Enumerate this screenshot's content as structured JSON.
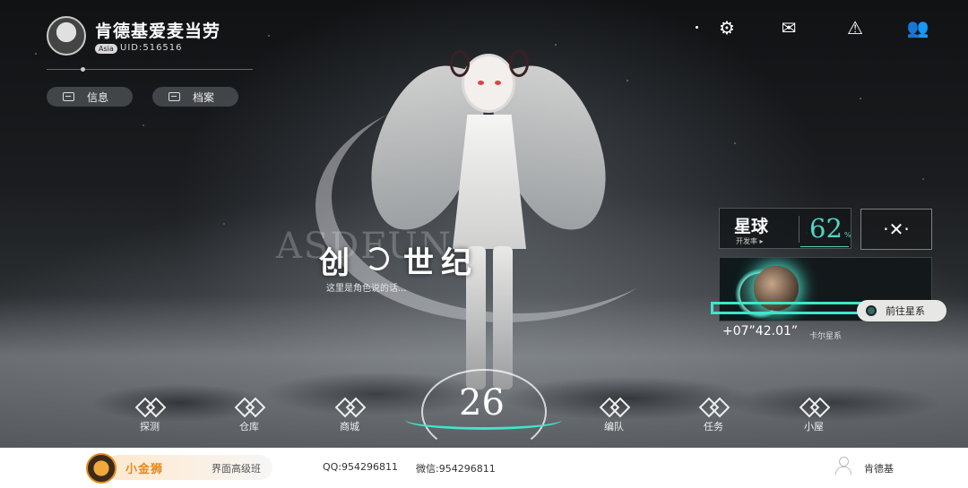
{
  "profile": {
    "username": "肯德基爱麦当劳",
    "region": "Asia",
    "uid": "UID:516516",
    "buttons": [
      {
        "label": "信息"
      },
      {
        "label": "档案"
      }
    ]
  },
  "top_icons": [
    "gear-icon",
    "mail-icon",
    "warning-icon",
    "friends-icon"
  ],
  "title": {
    "background_text": "ASDFUN",
    "main_text_left": "创",
    "main_text_right": "世纪",
    "subtitle": "这里是角色说的话..."
  },
  "planet_panel": {
    "name": "星球",
    "rate_label": "开发率 ▸",
    "rate_value": "62",
    "rate_unit": "%",
    "close_symbol": "·✕·",
    "go_button_label": "前往星系",
    "coordinate": "+07”42.01”",
    "galaxy_name": "卡尔星系",
    "accent_color": "#3ee6c9"
  },
  "level": "26",
  "bottom_nav": [
    {
      "label": "探测"
    },
    {
      "label": "仓库"
    },
    {
      "label": "商城"
    },
    {
      "label": "编队"
    },
    {
      "label": "任务"
    },
    {
      "label": "小屋"
    }
  ],
  "footer": {
    "brand_name": "小金狮",
    "brand_tag": "界面高级班",
    "qq": "QQ:954296811",
    "wechat": "微信:954296811",
    "user_name": "肯德基",
    "brand_color": "#e48a1e"
  }
}
